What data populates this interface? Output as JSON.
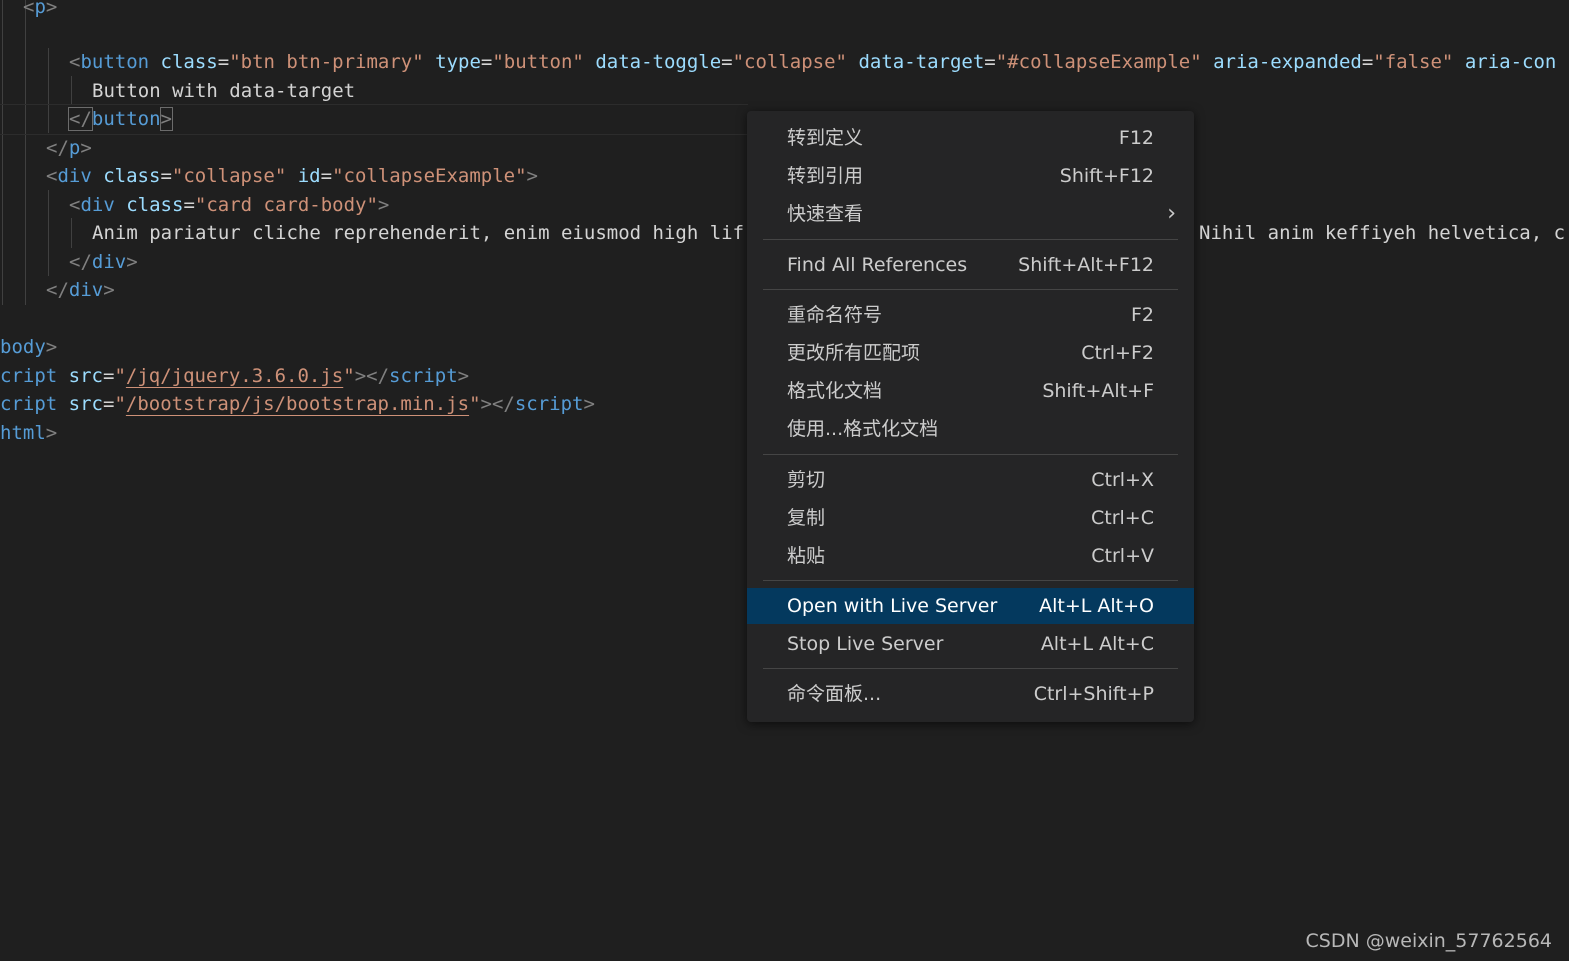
{
  "editor": {
    "l1": {
      "open": "<",
      "tag": "p",
      "close": ">"
    },
    "l2": {
      "open": "<",
      "tag": "button",
      "a1": "class",
      "v1": "\"btn btn-primary\"",
      "a2": "type",
      "v2": "\"button\"",
      "a3": "data-toggle",
      "v3": "\"collapse\"",
      "a4": "data-target",
      "v4": "\"#collapseExample\"",
      "a5": "aria-expanded",
      "v5": "\"false\"",
      "a6": "aria-con",
      "eq": "="
    },
    "l3": {
      "text": "Button with data-target"
    },
    "l4": {
      "open": "</",
      "tag": "button",
      "close": ">"
    },
    "l5": {
      "open": "</",
      "tag": "p",
      "close": ">"
    },
    "l6": {
      "open": "<",
      "tag": "div",
      "a1": "class",
      "v1": "\"collapse\"",
      "a2": "id",
      "v2": "\"collapseExample\"",
      "close": ">",
      "eq": "="
    },
    "l7": {
      "open": "<",
      "tag": "div",
      "a1": "class",
      "v1": "\"card card-body\"",
      "close": ">",
      "eq": "="
    },
    "l8": {
      "left": "Anim pariatur cliche reprehenderit, enim eiusmod high lif",
      "right": "Nihil anim keffiyeh helvetica, c"
    },
    "l9": {
      "open": "</",
      "tag": "div",
      "close": ">"
    },
    "l10": {
      "open": "</",
      "tag": "div",
      "close": ">"
    },
    "l11": {
      "tag": "body",
      "close": ">"
    },
    "l12": {
      "tag": "cript",
      "a1": "src",
      "eq": "=",
      "q": "\"",
      "link": "/jq/jquery.3.6.0.js",
      "close": "></",
      "tag2": "script",
      "close2": ">"
    },
    "l13": {
      "tag": "cript",
      "a1": "src",
      "eq": "=",
      "q": "\"",
      "link": "/bootstrap/js/bootstrap.min.js",
      "close": "></",
      "tag2": "script",
      "close2": ">"
    },
    "l14": {
      "tag": "html",
      "close": ">"
    }
  },
  "context_menu": {
    "items": [
      {
        "label": "转到定义",
        "shortcut": "F12"
      },
      {
        "label": "转到引用",
        "shortcut": "Shift+F12"
      },
      {
        "label": "快速查看",
        "chevron": "›",
        "icon": "chevron-right-icon"
      },
      {
        "label": "Find All References",
        "shortcut": "Shift+Alt+F12"
      },
      {
        "label": "重命名符号",
        "shortcut": "F2"
      },
      {
        "label": "更改所有匹配项",
        "shortcut": "Ctrl+F2"
      },
      {
        "label": "格式化文档",
        "shortcut": "Shift+Alt+F"
      },
      {
        "label": "使用...格式化文档",
        "shortcut": ""
      },
      {
        "label": "剪切",
        "shortcut": "Ctrl+X"
      },
      {
        "label": "复制",
        "shortcut": "Ctrl+C"
      },
      {
        "label": "粘贴",
        "shortcut": "Ctrl+V"
      },
      {
        "label": "Open with Live Server",
        "shortcut": "Alt+L Alt+O",
        "selected": true
      },
      {
        "label": "Stop Live Server",
        "shortcut": "Alt+L Alt+C"
      },
      {
        "label": "命令面板...",
        "shortcut": "Ctrl+Shift+P"
      }
    ]
  },
  "watermark": "CSDN @weixin_57762564",
  "colors": {
    "background": "#1f1f1f",
    "menu_background": "#252526",
    "menu_selected": "#04395e",
    "tag": "#569cd6",
    "attribute": "#9cdcfe",
    "string": "#ce9178"
  }
}
